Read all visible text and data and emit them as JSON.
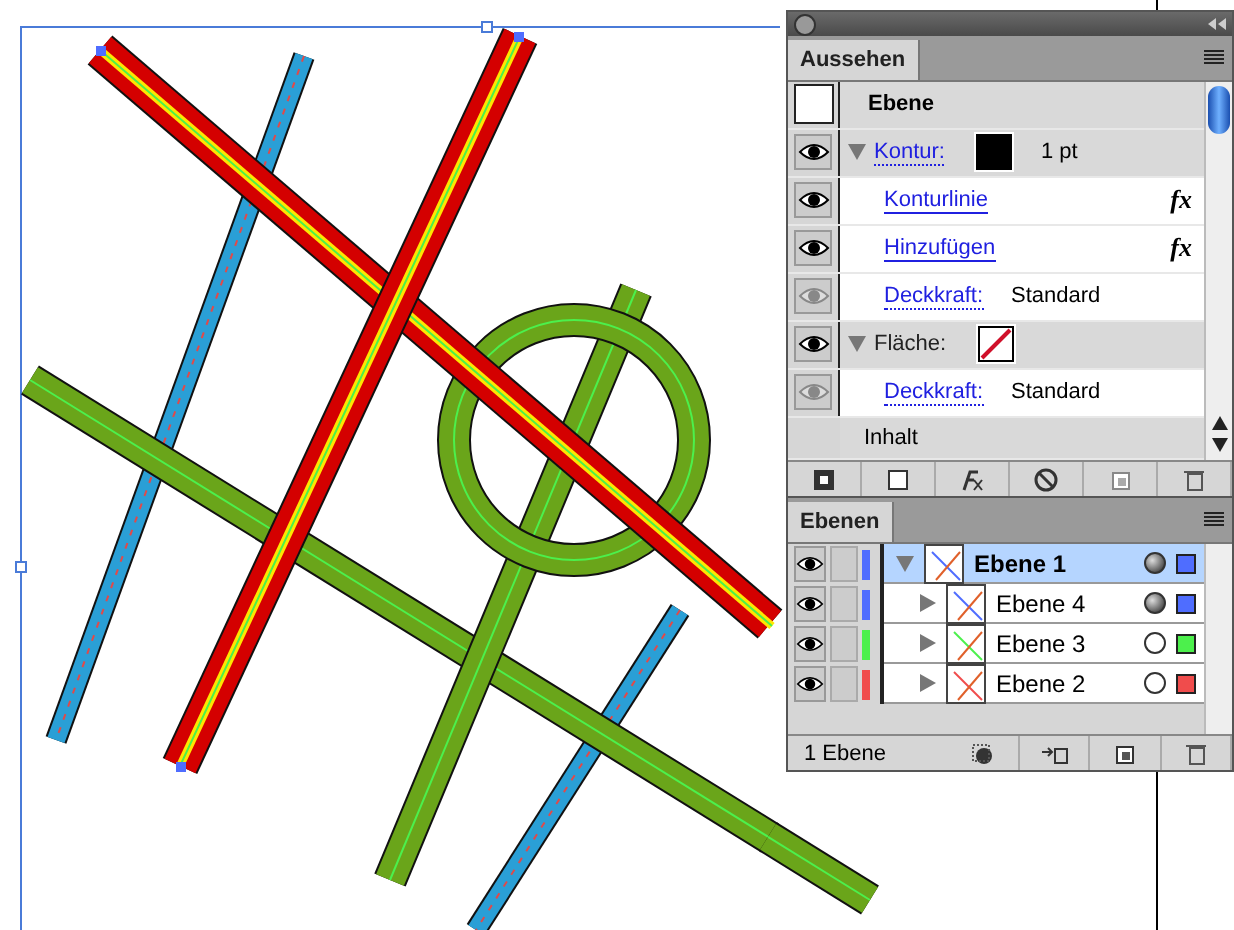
{
  "appearance": {
    "tab": "Aussehen",
    "rows": [
      {
        "kind": "title",
        "label": "Ebene"
      },
      {
        "kind": "attribute",
        "label": "Kontur:",
        "link": true,
        "expanded": true,
        "visible": true,
        "no_fill": false,
        "value": "1 pt"
      },
      {
        "kind": "effect",
        "label": "Konturlinie",
        "visible": true,
        "fx": "fx"
      },
      {
        "kind": "effect",
        "label": "Hinzufügen",
        "visible": true,
        "fx": "fx"
      },
      {
        "kind": "opacity",
        "label": "Deckkraft:",
        "visible": false,
        "value": "Standard"
      },
      {
        "kind": "attribute",
        "label": "Fläche:",
        "link": false,
        "expanded": true,
        "visible": true,
        "no_fill": true
      },
      {
        "kind": "opacity",
        "label": "Deckkraft:",
        "visible": false,
        "value": "Standard"
      },
      {
        "kind": "content",
        "label": "Inhalt"
      }
    ]
  },
  "layers": {
    "tab": "Ebenen",
    "footer": "1 Ebene",
    "items": [
      {
        "name": "Ebene 1",
        "selected": true,
        "expanded": true,
        "targeted": true,
        "color": "#4f6dff",
        "children": [
          {
            "name": "Ebene 4",
            "selected": false,
            "expanded": false,
            "targeted": true,
            "color": "#4f6dff"
          },
          {
            "name": "Ebene 3",
            "selected": false,
            "expanded": false,
            "targeted": false,
            "color": "#4cf04c"
          },
          {
            "name": "Ebene 2",
            "selected": false,
            "expanded": false,
            "targeted": false,
            "color": "#f04c4c"
          }
        ]
      }
    ]
  }
}
